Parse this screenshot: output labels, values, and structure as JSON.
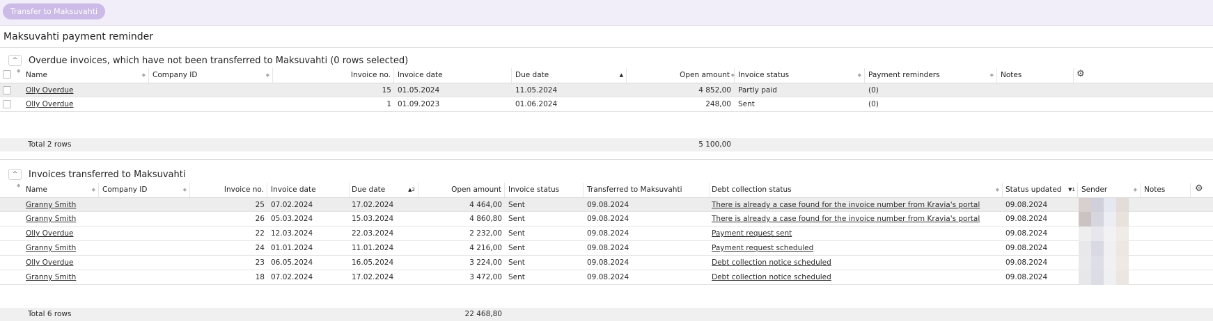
{
  "toolbar": {
    "transfer_label": "Transfer to Maksuvahti"
  },
  "page": {
    "title": "Maksuvahti payment reminder"
  },
  "overdue": {
    "title": "Overdue invoices, which have not been transferred to Maksuvahti (0 rows selected)",
    "columns": {
      "name": "Name",
      "company_id": "Company ID",
      "invoice_no": "Invoice no.",
      "invoice_date": "Invoice date",
      "due_date": "Due date",
      "open_amount": "Open amount",
      "invoice_status": "Invoice status",
      "payment_reminders": "Payment reminders",
      "notes": "Notes"
    },
    "rows": [
      {
        "name": "Olly Overdue",
        "company_id": "",
        "invoice_no": "15",
        "invoice_date": "01.05.2024",
        "due_date": "11.05.2024",
        "open_amount": "4 852,00",
        "invoice_status": "Partly paid",
        "payment_reminders": "(0)",
        "notes": ""
      },
      {
        "name": "Olly Overdue",
        "company_id": "",
        "invoice_no": "1",
        "invoice_date": "01.09.2023",
        "due_date": "01.06.2024",
        "open_amount": "248,00",
        "invoice_status": "Sent",
        "payment_reminders": "(0)",
        "notes": ""
      }
    ],
    "total_label": "Total 2 rows",
    "total_amount": "5 100,00"
  },
  "transferred": {
    "title": "Invoices transferred to Maksuvahti",
    "columns": {
      "name": "Name",
      "company_id": "Company ID",
      "invoice_no": "Invoice no.",
      "invoice_date": "Invoice date",
      "due_date": "Due date",
      "due_date_sort": "2",
      "open_amount": "Open amount",
      "invoice_status": "Invoice status",
      "transferred": "Transferred to Maksuvahti",
      "debt_status": "Debt collection status",
      "status_updated": "Status updated",
      "status_updated_sort": "1",
      "sender": "Sender",
      "notes": "Notes"
    },
    "rows": [
      {
        "name": "Granny Smith",
        "invoice_no": "25",
        "invoice_date": "07.02.2024",
        "due_date": "17.02.2024",
        "open_amount": "4 464,00",
        "invoice_status": "Sent",
        "transferred": "09.08.2024",
        "debt_status": "There is already a case found for the invoice number from Kravia's portal",
        "status_updated": "09.08.2024"
      },
      {
        "name": "Granny Smith",
        "invoice_no": "26",
        "invoice_date": "05.03.2024",
        "due_date": "15.03.2024",
        "open_amount": "4 860,80",
        "invoice_status": "Sent",
        "transferred": "09.08.2024",
        "debt_status": "There is already a case found for the invoice number from Kravia's portal",
        "status_updated": "09.08.2024"
      },
      {
        "name": "Olly Overdue",
        "invoice_no": "22",
        "invoice_date": "12.03.2024",
        "due_date": "22.03.2024",
        "open_amount": "2 232,00",
        "invoice_status": "Sent",
        "transferred": "09.08.2024",
        "debt_status": "Payment request sent",
        "status_updated": "09.08.2024"
      },
      {
        "name": "Granny Smith",
        "invoice_no": "24",
        "invoice_date": "01.01.2024",
        "due_date": "11.01.2024",
        "open_amount": "4 216,00",
        "invoice_status": "Sent",
        "transferred": "09.08.2024",
        "debt_status": "Payment request scheduled",
        "status_updated": "09.08.2024"
      },
      {
        "name": "Olly Overdue",
        "invoice_no": "23",
        "invoice_date": "06.05.2024",
        "due_date": "16.05.2024",
        "open_amount": "3 224,00",
        "invoice_status": "Sent",
        "transferred": "09.08.2024",
        "debt_status": "Debt collection notice scheduled",
        "status_updated": "09.08.2024"
      },
      {
        "name": "Granny Smith",
        "invoice_no": "18",
        "invoice_date": "07.02.2024",
        "due_date": "17.02.2024",
        "open_amount": "3 472,00",
        "invoice_status": "Sent",
        "transferred": "09.08.2024",
        "debt_status": "Debt collection notice scheduled",
        "status_updated": "09.08.2024"
      }
    ],
    "total_label": "Total 6 rows",
    "total_amount": "22 468,80"
  },
  "icons": {
    "collapse": "chevron-up-icon",
    "settings": "gear-icon",
    "sort_neutral": "sort-diamond-icon",
    "sort_asc": "sort-ascending-icon"
  },
  "colors": {
    "toolbar_bg": "#f2eef9",
    "button_bg": "#cbbbe6",
    "highlight_row": "#ededed"
  }
}
